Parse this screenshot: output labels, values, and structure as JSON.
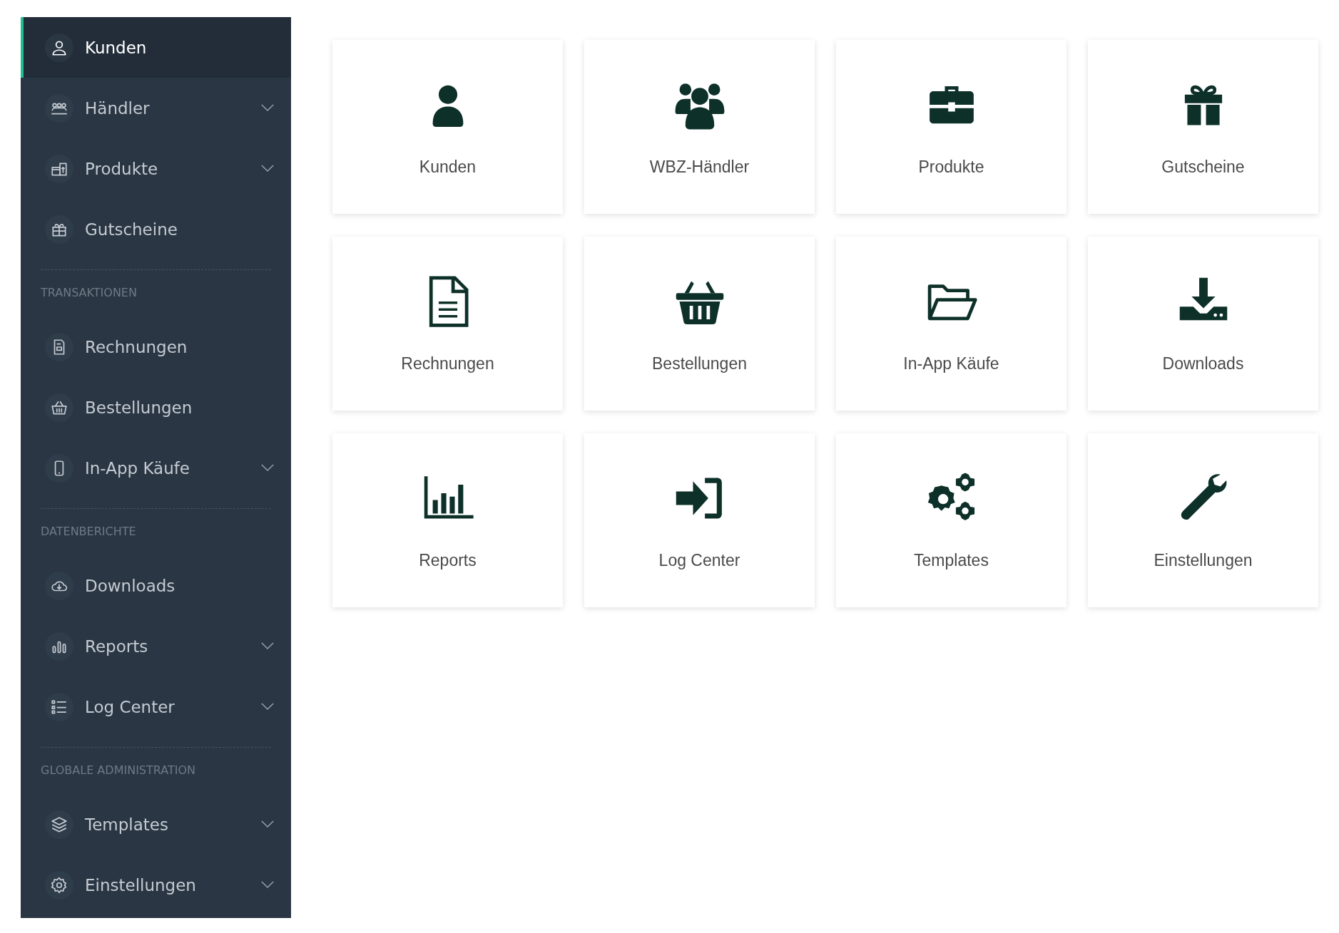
{
  "sidebar": {
    "items": [
      {
        "kind": "item",
        "label": "Kunden",
        "selected": true,
        "expandable": false
      },
      {
        "kind": "item",
        "label": "Händler",
        "selected": false,
        "expandable": true
      },
      {
        "kind": "item",
        "label": "Produkte",
        "selected": false,
        "expandable": true
      },
      {
        "kind": "item",
        "label": "Gutscheine",
        "selected": false,
        "expandable": false
      },
      {
        "kind": "section",
        "label": "TRANSAKTIONEN"
      },
      {
        "kind": "item",
        "label": "Rechnungen",
        "selected": false,
        "expandable": false
      },
      {
        "kind": "item",
        "label": "Bestellungen",
        "selected": false,
        "expandable": false
      },
      {
        "kind": "item",
        "label": "In-App Käufe",
        "selected": false,
        "expandable": true
      },
      {
        "kind": "section",
        "label": "DATENBERICHTE"
      },
      {
        "kind": "item",
        "label": "Downloads",
        "selected": false,
        "expandable": false
      },
      {
        "kind": "item",
        "label": "Reports",
        "selected": false,
        "expandable": true
      },
      {
        "kind": "item",
        "label": "Log Center",
        "selected": false,
        "expandable": true
      },
      {
        "kind": "section",
        "label": "GLOBALE ADMINISTRATION"
      },
      {
        "kind": "item",
        "label": "Templates",
        "selected": false,
        "expandable": true
      },
      {
        "kind": "item",
        "label": "Einstellungen",
        "selected": false,
        "expandable": true
      }
    ]
  },
  "tiles": [
    {
      "label": "Kunden"
    },
    {
      "label": "WBZ-Händler"
    },
    {
      "label": "Produkte"
    },
    {
      "label": "Gutscheine"
    },
    {
      "label": "Rechnungen"
    },
    {
      "label": "Bestellungen"
    },
    {
      "label": "In-App Käufe"
    },
    {
      "label": "Downloads"
    },
    {
      "label": "Reports"
    },
    {
      "label": "Log Center"
    },
    {
      "label": "Templates"
    },
    {
      "label": "Einstellungen"
    }
  ]
}
